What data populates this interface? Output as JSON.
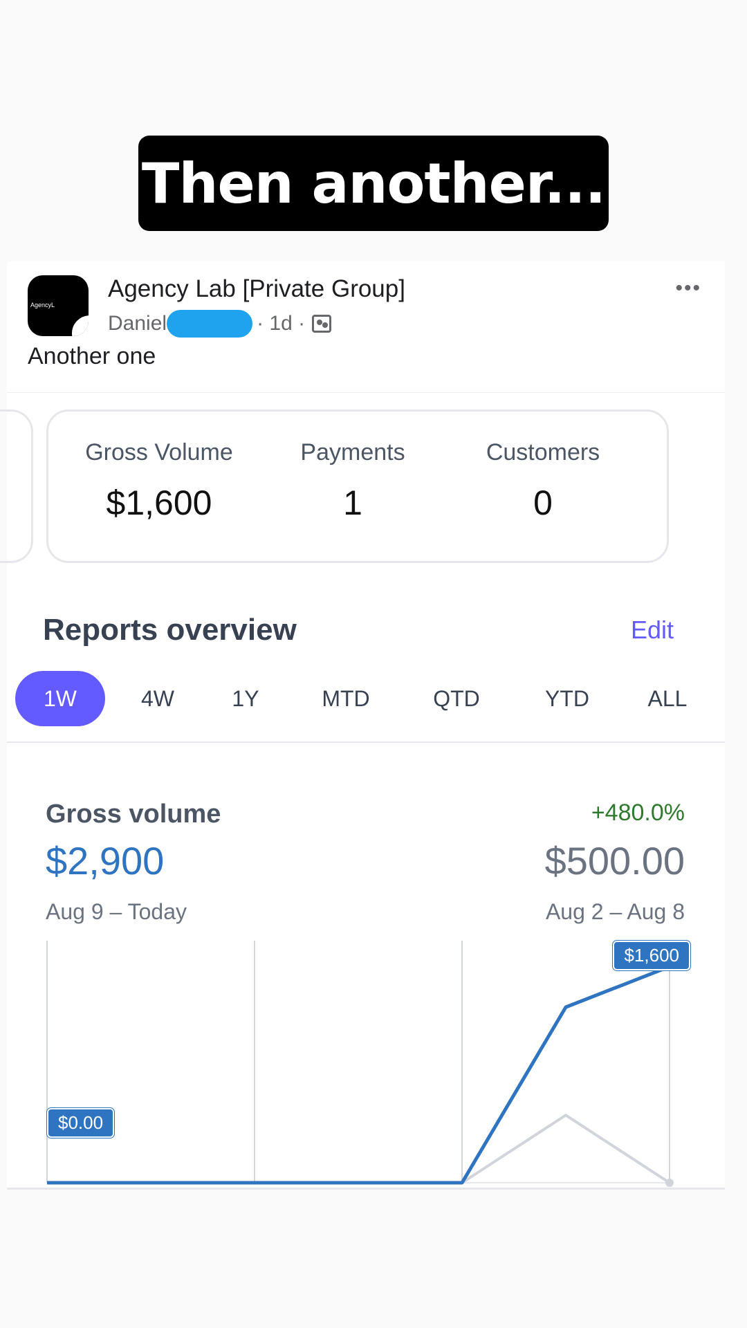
{
  "story": {
    "caption": "Then another..."
  },
  "post": {
    "group_name": "Agency Lab [Private Group]",
    "author": "Daniel",
    "time": "· 1d ·",
    "more_label": "•••",
    "text": "Another one",
    "avatar_text": "AgencyL"
  },
  "stats": [
    {
      "label": "Gross Volume",
      "value": "$1,600"
    },
    {
      "label": "Payments",
      "value": "1"
    },
    {
      "label": "Customers",
      "value": "0"
    }
  ],
  "reports": {
    "title": "Reports overview",
    "edit_label": "Edit",
    "tabs": [
      "1W",
      "4W",
      "1Y",
      "MTD",
      "QTD",
      "YTD",
      "ALL"
    ],
    "active_tab": "1W"
  },
  "gross_volume": {
    "title": "Gross volume",
    "change": "+480.0%",
    "value": "$2,900",
    "previous_value": "$500.00",
    "range": "Aug 9 – Today",
    "previous_range": "Aug 2 – Aug 8"
  },
  "chart_data": {
    "type": "line",
    "x": [
      0,
      1,
      2,
      3,
      4,
      5,
      6
    ],
    "series": [
      {
        "values": [
          0,
          0,
          0,
          0,
          0,
          1300,
          1600
        ],
        "color": "#2f74c0"
      },
      {
        "values": [
          0,
          0,
          0,
          0,
          0,
          500,
          0
        ],
        "color": "#d1d5db"
      }
    ],
    "ylim": [
      0,
      1700
    ],
    "labels": {
      "peak": "$1,600",
      "zero": "$0.00"
    },
    "grid": true
  }
}
